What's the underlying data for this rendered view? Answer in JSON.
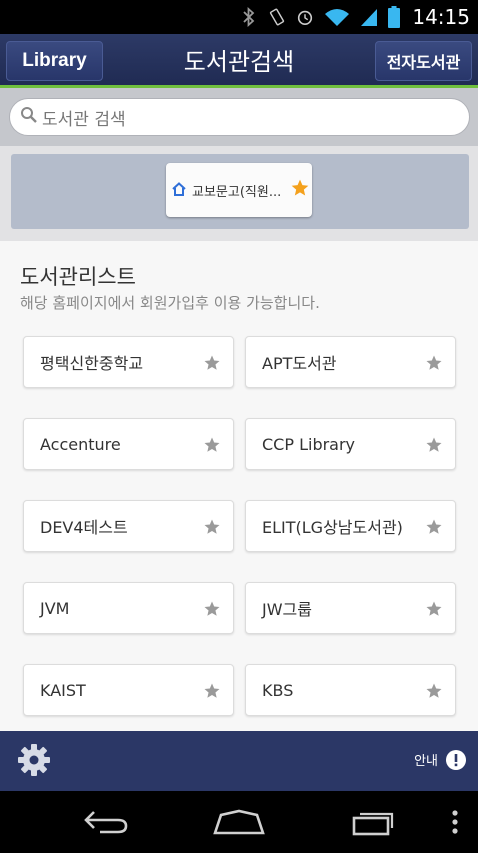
{
  "status": {
    "time": "14:15"
  },
  "header": {
    "library_label": "Library",
    "title": "도서관검색",
    "ebook_label": "전자도서관"
  },
  "search": {
    "placeholder": "도서관 검색"
  },
  "favorites": [
    {
      "label": "교보문고(직원...",
      "home_icon": "home-icon",
      "star_color": "#f4a11d"
    }
  ],
  "list": {
    "title": "도서관리스트",
    "subtitle": "해당 홈페이지에서 회원가입후 이용 가능합니다.",
    "items": [
      "평택신한중학교",
      "APT도서관",
      "Accenture",
      "CCP Library",
      "DEV4테스트",
      "ELIT(LG상남도서관)",
      "JVM",
      "JW그룹",
      "KAIST",
      "KBS"
    ]
  },
  "toolbar": {
    "guide_label": "안내"
  },
  "colors": {
    "header_bg": "#25315c",
    "accent_green": "#6fbf3d",
    "star_gray": "#9a9a9a",
    "star_orange": "#f4a11d"
  }
}
